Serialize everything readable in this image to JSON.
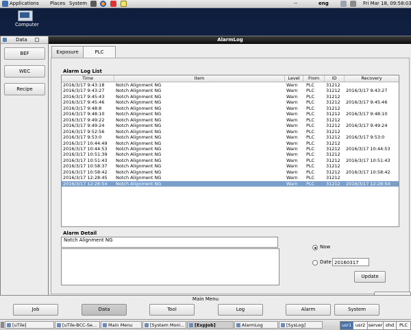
{
  "top_panel": {
    "menus": [
      "Applications",
      "Places",
      "System"
    ],
    "keyboard": "eng",
    "datetime": "Fri Mar 18, 09:58:03"
  },
  "desktop": {
    "icon_label": "Computer"
  },
  "data_window": {
    "title": "Data",
    "buttons": [
      "BEF",
      "WEC",
      "Recipe"
    ]
  },
  "alarm_window": {
    "title": "AlarmLog",
    "tabs": [
      {
        "label": "Exposure",
        "active": false
      },
      {
        "label": "PLC",
        "active": true
      }
    ],
    "list_title": "Alarm Log List",
    "columns": [
      "Time",
      "Item",
      "Level",
      "From",
      "ID",
      "Recovery"
    ],
    "rows": [
      {
        "time": "2016/3/17 9:43:18",
        "item": "Notch Alignment NG",
        "level": "Warn",
        "from": "PLC",
        "id": "31212",
        "recovery": ""
      },
      {
        "time": "2016/3/17 9:43:27",
        "item": "Notch Alignment NG",
        "level": "Warn",
        "from": "PLC",
        "id": "31212",
        "recovery": "2016/3/17 9:43:27"
      },
      {
        "time": "2016/3/17 9:45:43",
        "item": "Notch Alignment NG",
        "level": "Warn",
        "from": "PLC",
        "id": "31212",
        "recovery": ""
      },
      {
        "time": "2016/3/17 9:45:46",
        "item": "Notch Alignment NG",
        "level": "Warn",
        "from": "PLC",
        "id": "31212",
        "recovery": "2016/3/17 9:45:46"
      },
      {
        "time": "2016/3/17 9:48:8",
        "item": "Notch Alignment NG",
        "level": "Warn",
        "from": "PLC",
        "id": "31212",
        "recovery": ""
      },
      {
        "time": "2016/3/17 9:48:10",
        "item": "Notch Alignment NG",
        "level": "Warn",
        "from": "PLC",
        "id": "31212",
        "recovery": "2016/3/17 9:48:10"
      },
      {
        "time": "2016/3/17 9:49:22",
        "item": "Notch Alignment NG",
        "level": "Warn",
        "from": "PLC",
        "id": "31212",
        "recovery": ""
      },
      {
        "time": "2016/3/17 9:49:24",
        "item": "Notch Alignment NG",
        "level": "Warn",
        "from": "PLC",
        "id": "31212",
        "recovery": "2016/3/17 9:49:24"
      },
      {
        "time": "2016/3/17 9:52:56",
        "item": "Notch Alignment NG",
        "level": "Warn",
        "from": "PLC",
        "id": "31212",
        "recovery": ""
      },
      {
        "time": "2016/3/17 9:53:0",
        "item": "Notch Alignment NG",
        "level": "Warn",
        "from": "PLC",
        "id": "31212",
        "recovery": "2016/3/17 9:53:0"
      },
      {
        "time": "2016/3/17 10:44:49",
        "item": "Notch Alignment NG",
        "level": "Warn",
        "from": "PLC",
        "id": "31212",
        "recovery": ""
      },
      {
        "time": "2016/3/17 10:44:53",
        "item": "Notch Alignment NG",
        "level": "Warn",
        "from": "PLC",
        "id": "31212",
        "recovery": "2016/3/17 10:44:53"
      },
      {
        "time": "2016/3/17 10:51:39",
        "item": "Notch Alignment NG",
        "level": "Warn",
        "from": "PLC",
        "id": "31212",
        "recovery": ""
      },
      {
        "time": "2016/3/17 10:51:43",
        "item": "Notch Alignment NG",
        "level": "Warn",
        "from": "PLC",
        "id": "31212",
        "recovery": "2016/3/17 10:51:43"
      },
      {
        "time": "2016/3/17 10:58:37",
        "item": "Notch Alignment NG",
        "level": "Warn",
        "from": "PLC",
        "id": "31212",
        "recovery": ""
      },
      {
        "time": "2016/3/17 10:58:42",
        "item": "Notch Alignment NG",
        "level": "Warn",
        "from": "PLC",
        "id": "31212",
        "recovery": "2016/3/17 10:58:42"
      },
      {
        "time": "2016/3/17 12:28:45",
        "item": "Notch Alignment NG",
        "level": "Warn",
        "from": "PLC",
        "id": "31212",
        "recovery": ""
      },
      {
        "time": "2016/3/17 12:28:54",
        "item": "Notch Alignment NG",
        "level": "Warn",
        "from": "PLC",
        "id": "31212",
        "recovery": "2016/3/17 12:28:54",
        "selected": true
      }
    ],
    "detail_title": "Alarm Detail",
    "detail_text": "Notch Alignment NG",
    "radio_now": "Now",
    "radio_date": "Date",
    "date_value": "20160317",
    "update_label": "Update"
  },
  "main_menu": {
    "title": "Main Menu",
    "buttons": [
      {
        "label": "Job",
        "active": false
      },
      {
        "label": "Data",
        "active": true
      },
      {
        "label": "Tool",
        "active": false
      },
      {
        "label": "Log",
        "active": false
      },
      {
        "label": "Alarm",
        "active": false
      },
      {
        "label": "System",
        "active": false
      }
    ]
  },
  "taskbar": {
    "tasks": [
      {
        "label": "[uTile]",
        "active": false
      },
      {
        "label": "[uTile-BCC-Se...",
        "active": false
      },
      {
        "label": "Main Menu",
        "active": false
      },
      {
        "label": "[System Moni...",
        "active": false
      },
      {
        "label": "[ExpJob]",
        "active": true
      },
      {
        "label": "AlarmLog",
        "active": false
      },
      {
        "label": "[SysLog]",
        "active": false
      }
    ],
    "workspaces": [
      {
        "label": "usr1",
        "active": true
      },
      {
        "label": "usr2",
        "active": false
      },
      {
        "label": "server",
        "active": false
      },
      {
        "label": "ohd",
        "active": false
      },
      {
        "label": "PLC",
        "active": false
      }
    ]
  },
  "colors": {
    "selection": "#7b9fcb",
    "active_workspace": "#4b72a8"
  }
}
